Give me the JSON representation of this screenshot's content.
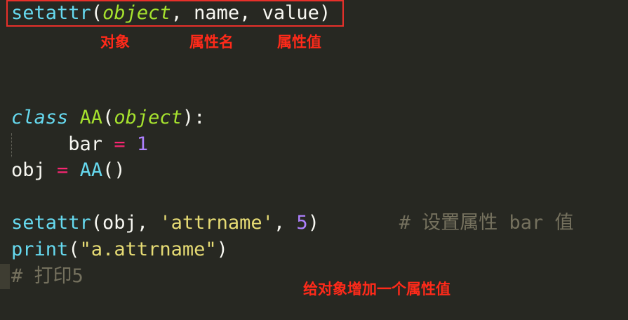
{
  "code": {
    "line1": {
      "fn": "setattr",
      "open": "(",
      "param": "object",
      "rest": ", name, value",
      "close": ")"
    },
    "line2": {
      "kw": "class",
      "space": " ",
      "name": "AA",
      "open": "(",
      "param": "object",
      "close": "):"
    },
    "line3": {
      "indent": "     ",
      "var": "bar",
      "eq": " = ",
      "num": "1"
    },
    "line4": {
      "var": "obj",
      "eq": " = ",
      "cls": "AA",
      "call": "()"
    },
    "line5": {
      "fn": "setattr",
      "open": "(obj, ",
      "str": "'attrname'",
      "sep": ", ",
      "num": "5",
      "close": ")",
      "gap": "       ",
      "comment": "# 设置属性 bar 值"
    },
    "line6": {
      "fn": "print",
      "open": "(",
      "str": "\"a.attrname\"",
      "close": ")"
    },
    "line7": {
      "comment": "# 打印5"
    }
  },
  "annotations": {
    "object_label": "对象",
    "name_label": "属性名",
    "value_label": "属性值",
    "summary_label": "给对象增加一个属性值"
  },
  "colors": {
    "background": "#272822",
    "annotation_red": "#ff2a1a",
    "box_border": "#e8302a"
  }
}
